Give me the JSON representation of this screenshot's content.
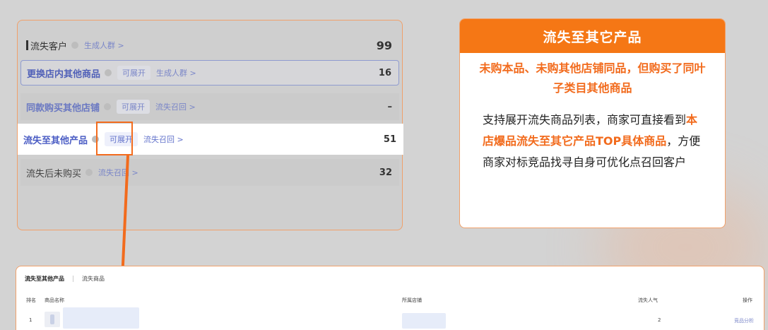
{
  "funnel": {
    "header": {
      "label": "流失客户",
      "action": "生成人群 >",
      "value": "99"
    },
    "rows": [
      {
        "name": "更换店内其他商品",
        "tag": "可展开",
        "action": "生成人群 >",
        "value": "16"
      },
      {
        "name": "同款购买其他店铺",
        "tag": "可展开",
        "action": "流失召回 >",
        "value": "–"
      },
      {
        "name": "流失至其他产品",
        "tag": "可展开",
        "action": "流失召回 >",
        "value": "51"
      },
      {
        "name": "流失后未购买",
        "action": "流失召回 >",
        "value": "32"
      }
    ]
  },
  "card": {
    "title": "流失至其它产品",
    "subtitle": "未购本品、未购其他店铺同品，但购买了同叶子类目其他商品",
    "body_1": "支持展开流失商品列表，商家可直接看到",
    "body_highlight": "本店爆品流失至其它产品TOP具体商品",
    "body_2": "，方便商家对标竞品找寻自身可优化点召回客户"
  },
  "table": {
    "tabs": [
      "流失至其他产品",
      "流失商品"
    ],
    "columns": [
      "排名",
      "商品名称",
      "所属店铺",
      "流失人气",
      "操作"
    ],
    "rows": [
      {
        "rank": "1",
        "lost": "2",
        "action": "竞品分析"
      }
    ]
  },
  "colors": {
    "accent": "#f57715",
    "link": "#7a86c8"
  }
}
